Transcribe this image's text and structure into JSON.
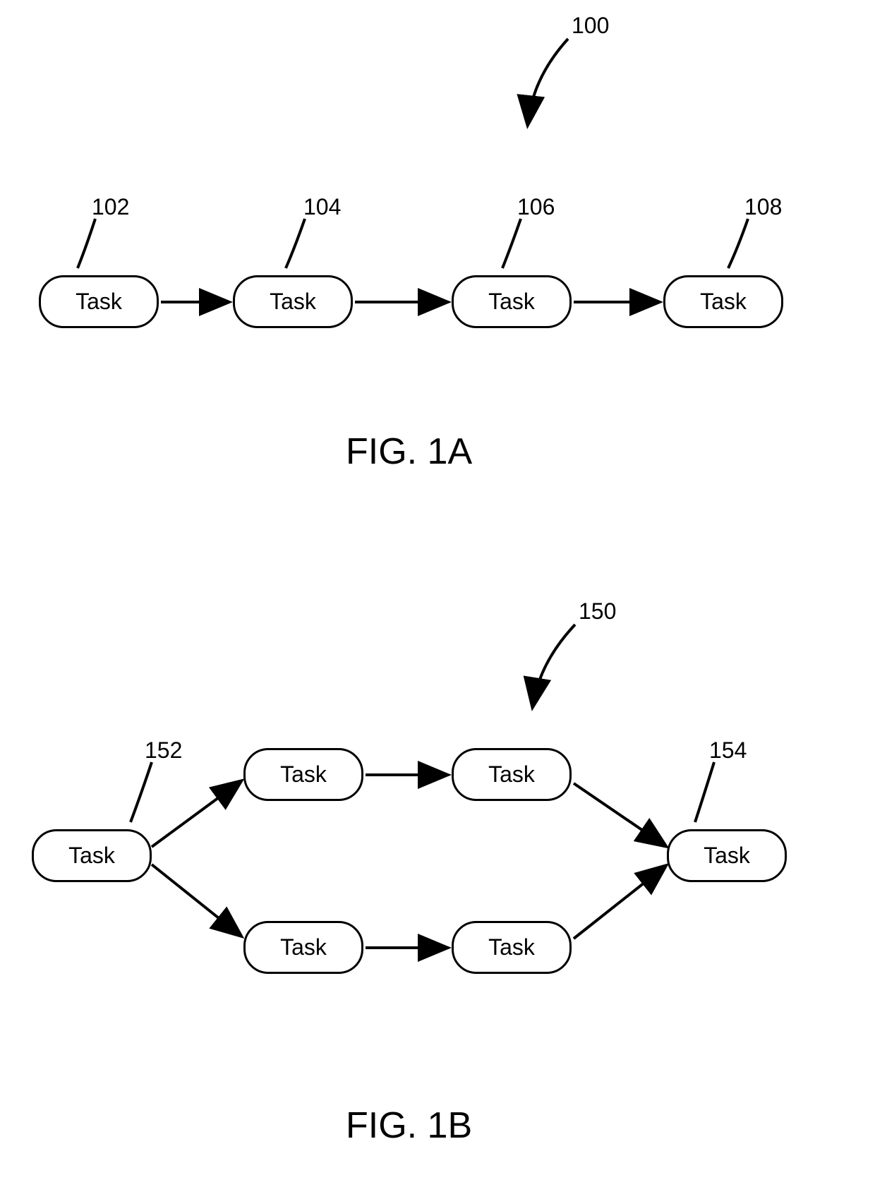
{
  "figA": {
    "ref_main": "100",
    "nodes": {
      "n1": {
        "label": "Task",
        "ref": "102"
      },
      "n2": {
        "label": "Task",
        "ref": "104"
      },
      "n3": {
        "label": "Task",
        "ref": "106"
      },
      "n4": {
        "label": "Task",
        "ref": "108"
      }
    },
    "caption": "FIG. 1A"
  },
  "figB": {
    "ref_main": "150",
    "nodes": {
      "n1": {
        "label": "Task",
        "ref": "152"
      },
      "n2": {
        "label": "Task"
      },
      "n3": {
        "label": "Task"
      },
      "n4": {
        "label": "Task"
      },
      "n5": {
        "label": "Task"
      },
      "n6": {
        "label": "Task",
        "ref": "154"
      }
    },
    "caption": "FIG. 1B"
  }
}
